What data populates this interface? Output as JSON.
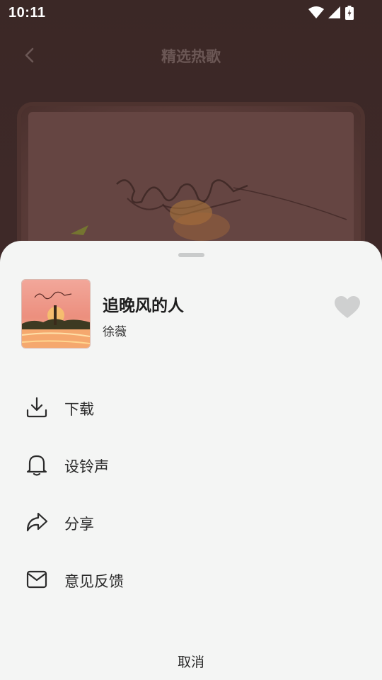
{
  "status_bar": {
    "time": "10:11"
  },
  "background_page": {
    "title": "精选热歌"
  },
  "sheet": {
    "song": {
      "title": "追晚风的人",
      "artist": "徐薇"
    },
    "menu": [
      {
        "label": "下载",
        "icon": "download-icon"
      },
      {
        "label": "设铃声",
        "icon": "bell-icon"
      },
      {
        "label": "分享",
        "icon": "share-icon"
      },
      {
        "label": "意见反馈",
        "icon": "mail-icon"
      }
    ],
    "cancel_label": "取消"
  },
  "colors": {
    "sheet_background": "#f4f5f4",
    "page_background": "#3a2624",
    "like_icon": "#cfd0d0"
  }
}
